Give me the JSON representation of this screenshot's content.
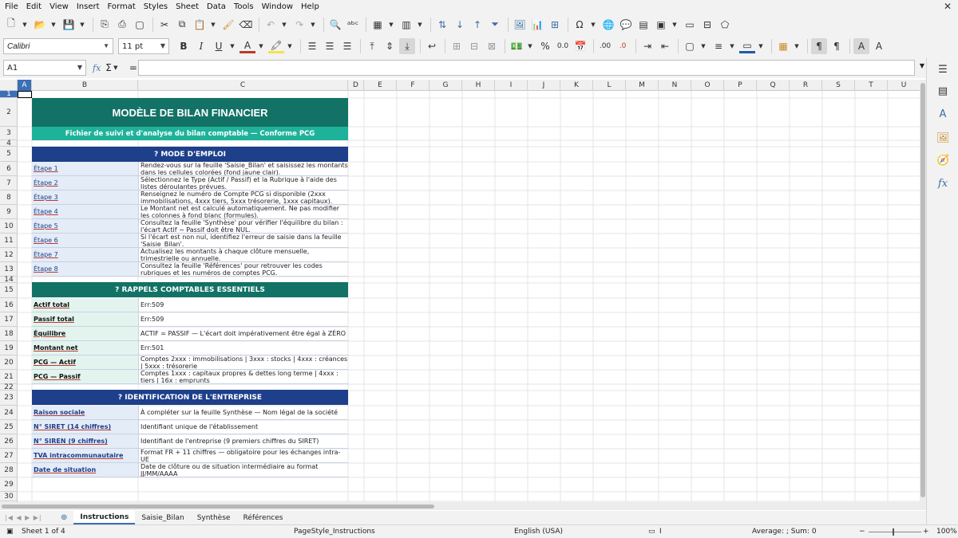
{
  "menu": [
    "File",
    "Edit",
    "View",
    "Insert",
    "Format",
    "Styles",
    "Sheet",
    "Data",
    "Tools",
    "Window",
    "Help"
  ],
  "toolbar": {
    "font_name": "Calibri",
    "font_size": "11 pt",
    "bold": "B",
    "italic": "I",
    "underline": "U",
    "percent": "%",
    "decimal": "0.0",
    "add_decimal": ".00",
    "del_decimal": ".0"
  },
  "formula_bar": {
    "cell_ref": "A1",
    "fx": "fx",
    "sum": "Σ",
    "equals": "=",
    "value": ""
  },
  "columns": [
    "A",
    "B",
    "C",
    "D",
    "E",
    "F",
    "G",
    "H",
    "I",
    "J",
    "K",
    "L",
    "M",
    "N",
    "O",
    "P",
    "Q",
    "R",
    "S",
    "T",
    "U"
  ],
  "rows": [
    "1",
    "2",
    "3",
    "4",
    "5",
    "6",
    "7",
    "8",
    "9",
    "10",
    "11",
    "12",
    "13",
    "14",
    "15",
    "16",
    "17",
    "18",
    "19",
    "20",
    "21",
    "22",
    "23",
    "24",
    "25",
    "26",
    "27",
    "28",
    "29",
    "30"
  ],
  "sheet": {
    "title": "MODÈLE DE BILAN FINANCIER",
    "subtitle": "Fichier de suivi et d'analyse du bilan comptable — Conforme PCG",
    "section1": "? MODE D'EMPLOI",
    "steps": [
      {
        "label": "Étape 1",
        "text": "Rendez-vous sur la feuille 'Saisie_Bilan' et saisissez les montants dans les cellules colorées (fond jaune clair)."
      },
      {
        "label": "Étape 2",
        "text": "Sélectionnez le Type (Actif / Passif) et la Rubrique à l'aide des listes déroulantes prévues."
      },
      {
        "label": "Étape 3",
        "text": "Renseignez le numéro de Compte PCG si disponible (2xxx immobilisations, 4xxx tiers, 5xxx trésorerie, 1xxx capitaux)."
      },
      {
        "label": "Étape 4",
        "text": "Le Montant net est calculé automatiquement. Ne pas modifier les colonnes à fond blanc (formules)."
      },
      {
        "label": "Étape 5",
        "text": "Consultez la feuille 'Synthèse' pour vérifier l'équilibre du bilan : l'écart Actif − Passif doit être NUL."
      },
      {
        "label": "Étape 6",
        "text": "Si l'écart est non nul, identifiez l'erreur de saisie dans la feuille 'Saisie_Bilan'."
      },
      {
        "label": "Étape 7",
        "text": "Actualisez les montants à chaque clôture mensuelle, trimestrielle ou annuelle."
      },
      {
        "label": "Étape 8",
        "text": "Consultez la feuille 'Références' pour retrouver les codes rubriques et les numéros de comptes PCG."
      }
    ],
    "section2": "? RAPPELS COMPTABLES ESSENTIELS",
    "reminders": [
      {
        "label": "Actif total",
        "text": "Err:509"
      },
      {
        "label": "Passif total",
        "text": "Err:509"
      },
      {
        "label": "Équilibre",
        "text": "ACTIF = PASSIF — L'écart doit impérativement être égal à ZÉRO"
      },
      {
        "label": "Montant net",
        "text": "Err:501"
      },
      {
        "label": "PCG — Actif",
        "text": "Comptes 2xxx : immobilisations | 3xxx : stocks | 4xxx : créances | 5xxx : trésorerie"
      },
      {
        "label": "PCG — Passif",
        "text": "Comptes 1xxx : capitaux propres & dettes long terme | 4xxx : tiers | 16x : emprunts"
      }
    ],
    "section3": "? IDENTIFICATION DE L'ENTREPRISE",
    "identification": [
      {
        "label": "Raison sociale",
        "text": "À compléter sur la feuille Synthèse — Nom légal de la société"
      },
      {
        "label": "N° SIRET (14 chiffres)",
        "text": "Identifiant unique de l'établissement"
      },
      {
        "label": "N° SIREN (9 chiffres)",
        "text": "Identifiant de l'entreprise (9 premiers chiffres du SIRET)"
      },
      {
        "label": "TVA intracommunautaire",
        "text": "Format FR + 11 chiffres — obligatoire pour les échanges intra-UE"
      },
      {
        "label": "Date de situation",
        "text": "Date de clôture ou de situation intermédiaire au format JJ/MM/AAAA"
      }
    ]
  },
  "tabs": [
    "Instructions",
    "Saisie_Bilan",
    "Synthèse",
    "Références"
  ],
  "status": {
    "sheet": "Sheet 1 of 4",
    "page_style": "PageStyle_Instructions",
    "language": "English (USA)",
    "summary": "Average: ; Sum: 0",
    "zoom": "100%"
  }
}
